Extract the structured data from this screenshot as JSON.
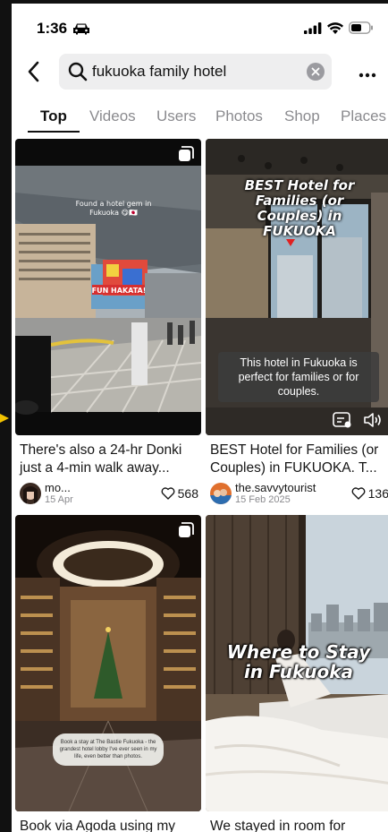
{
  "status_bar": {
    "time": "1:36"
  },
  "search": {
    "query": "fukuoka family hotel"
  },
  "tabs": [
    "Top",
    "Videos",
    "Users",
    "Photos",
    "Shop",
    "Places"
  ],
  "cards": [
    {
      "overlay_text": "Found a hotel gem in Fukuoka 😋🇯🇵",
      "sign_text": "FUN HAKATA!",
      "caption": "There's also a 24-hr Donki just a 4-min walk away...",
      "username": "mo...",
      "date": "15 Apr",
      "likes": "568"
    },
    {
      "overlay_text": "BEST Hotel for Families (or Couples) in FUKUOKA",
      "subtitle_text": "This hotel in Fukuoka is perfect for families or for couples.",
      "caption": "BEST Hotel for Families (or Couples) in FUKUOKA. T...",
      "username": "the.savvytourist",
      "date": "15 Feb 2025",
      "likes": "136"
    },
    {
      "overlay_text": "Book a stay at The Bastie Fukuoka - the grandest hotel lobby I've ever seen in my life, even better than photos.",
      "caption": "Book via Agoda using my"
    },
    {
      "overlay_text": "Where to Stay in Fukuoka",
      "caption": "We stayed in room for"
    }
  ]
}
